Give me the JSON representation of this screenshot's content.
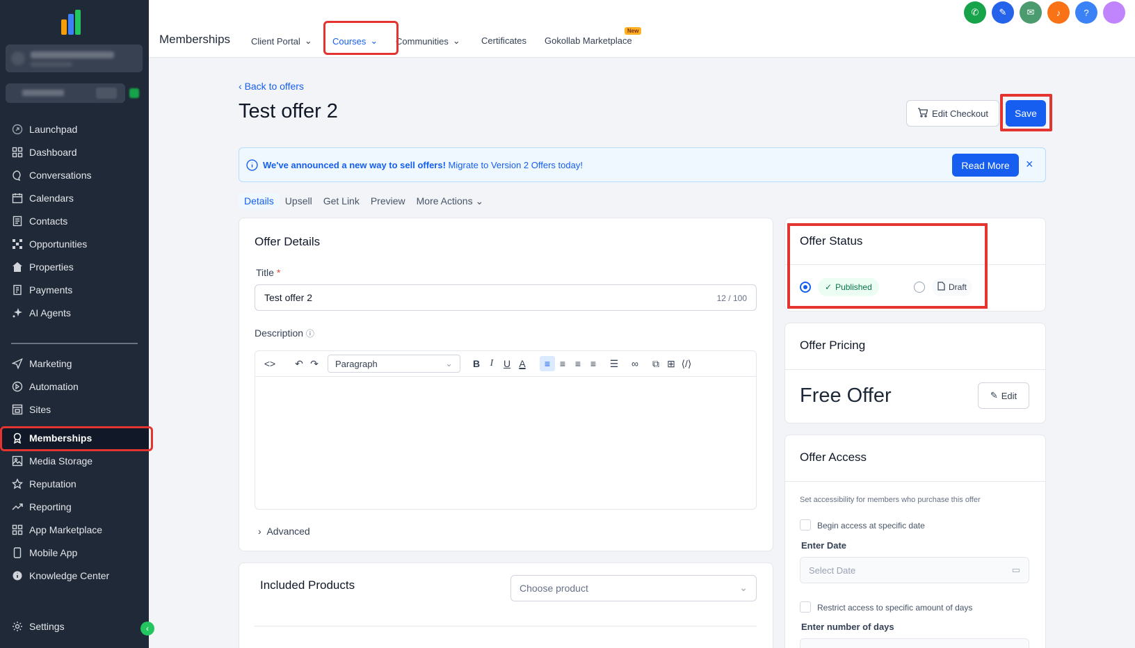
{
  "sidebar": {
    "items": [
      {
        "label": "Launchpad",
        "icon": "rocket-icon"
      },
      {
        "label": "Dashboard",
        "icon": "grid-icon"
      },
      {
        "label": "Conversations",
        "icon": "chat-icon"
      },
      {
        "label": "Calendars",
        "icon": "calendar-icon"
      },
      {
        "label": "Contacts",
        "icon": "contacts-icon"
      },
      {
        "label": "Opportunities",
        "icon": "network-icon"
      },
      {
        "label": "Properties",
        "icon": "home-icon"
      },
      {
        "label": "Payments",
        "icon": "receipt-icon"
      },
      {
        "label": "AI Agents",
        "icon": "sparkle-icon"
      },
      {
        "label": "Marketing",
        "icon": "send-icon"
      },
      {
        "label": "Automation",
        "icon": "automation-icon"
      },
      {
        "label": "Sites",
        "icon": "sites-icon"
      },
      {
        "label": "Memberships",
        "icon": "award-icon"
      },
      {
        "label": "Media Storage",
        "icon": "image-icon"
      },
      {
        "label": "Reputation",
        "icon": "star-icon"
      },
      {
        "label": "Reporting",
        "icon": "trend-icon"
      },
      {
        "label": "App Marketplace",
        "icon": "apps-icon"
      },
      {
        "label": "Mobile App",
        "icon": "mobile-icon"
      },
      {
        "label": "Knowledge Center",
        "icon": "info-icon"
      },
      {
        "label": "Settings",
        "icon": "gear-icon"
      }
    ],
    "active": "Memberships"
  },
  "topbar": {
    "title": "Memberships",
    "nav": [
      "Client Portal",
      "Courses",
      "Communities",
      "Certificates",
      "Gokollab Marketplace"
    ],
    "new_badge": "New"
  },
  "page": {
    "back": "Back to offers",
    "title": "Test offer 2",
    "edit_checkout": "Edit Checkout",
    "save": "Save"
  },
  "banner": {
    "bold": "We've announced a new way to sell offers!",
    "text": "Migrate to Version 2 Offers today!",
    "read_more": "Read More"
  },
  "tabs": [
    "Details",
    "Upsell",
    "Get Link",
    "Preview",
    "More Actions"
  ],
  "details": {
    "heading": "Offer Details",
    "title_label": "Title",
    "required_mark": "*",
    "title_value": "Test offer 2",
    "title_count": "12 / 100",
    "description_label": "Description",
    "paragraph_select": "Paragraph",
    "advanced": "Advanced"
  },
  "included": {
    "heading": "Included Products",
    "placeholder": "Choose product"
  },
  "status": {
    "heading": "Offer Status",
    "published": "Published",
    "draft": "Draft",
    "selected": "Published"
  },
  "pricing": {
    "heading": "Offer Pricing",
    "value": "Free Offer",
    "edit": "Edit"
  },
  "access": {
    "heading": "Offer Access",
    "description": "Set accessibility for members who purchase this offer",
    "begin_specific": "Begin access at specific date",
    "enter_date": "Enter Date",
    "date_placeholder": "Select Date",
    "restrict_days": "Restrict access to specific amount of days",
    "enter_days": "Enter number of days"
  },
  "colors": {
    "accent": "#155eef",
    "sidebar": "#1f2937",
    "highlight": "#e3342f"
  }
}
